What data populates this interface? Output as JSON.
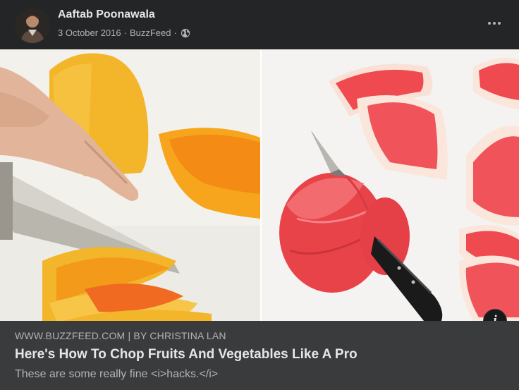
{
  "post": {
    "author": "Aaftab Poonawala",
    "date": "3 October 2016",
    "separator": "·",
    "source": "BuzzFeed",
    "audience_icon": "globe-icon",
    "more_icon": "more-horizontal-icon"
  },
  "media": {
    "info_icon": "info-icon",
    "info_glyph": "i"
  },
  "link": {
    "domain": "WWW.BUZZFEED.COM | BY CHRISTINA LAN",
    "title": "Here's How To Chop Fruits And Vegetables Like A Pro",
    "description": "These are some really fine <i>hacks.</i>"
  },
  "colors": {
    "background": "#242526",
    "link_background": "#3a3b3c",
    "text_primary": "#e4e6eb",
    "text_secondary": "#b0b3b8"
  }
}
